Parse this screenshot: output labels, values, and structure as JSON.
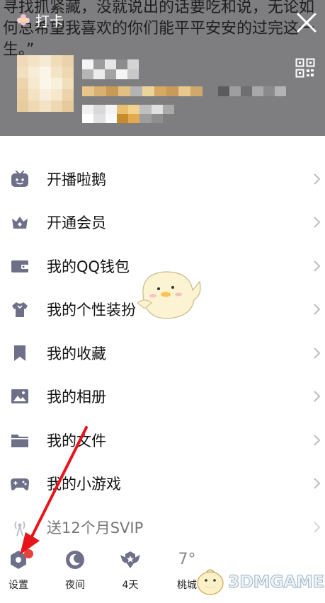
{
  "header": {
    "signature_lines": [
      "寻找抓紧藏，没就说出的话要吃和说，无论如",
      "何总希望我喜欢的你们能平平安安的过完这一",
      "生。”"
    ],
    "checkin_label": "打卡"
  },
  "menu": {
    "items": [
      {
        "label": "开播啦鹅",
        "icon": "tv-icon"
      },
      {
        "label": "开通会员",
        "icon": "crown-icon"
      },
      {
        "label": "我的QQ钱包",
        "icon": "wallet-icon"
      },
      {
        "label": "我的个性装扮",
        "icon": "shirt-icon"
      },
      {
        "label": "我的收藏",
        "icon": "bookmark-icon"
      },
      {
        "label": "我的相册",
        "icon": "image-icon"
      },
      {
        "label": "我的文件",
        "icon": "folder-icon"
      },
      {
        "label": "我的小游戏",
        "icon": "gamepad-icon"
      },
      {
        "label": "送12个月SVIP",
        "icon": "broadcast-icon"
      }
    ]
  },
  "bottom_bar": {
    "settings_label": "设置",
    "night_label": "夜间",
    "days_label": "4天",
    "weather_temp": "7°",
    "weather_city": "桃城"
  },
  "watermark": "3DMGAME",
  "colors": {
    "header_bg": "#7e7e80",
    "icon_color": "#6e708a",
    "red_dot": "#e8423d",
    "arrow": "#e8141b"
  }
}
